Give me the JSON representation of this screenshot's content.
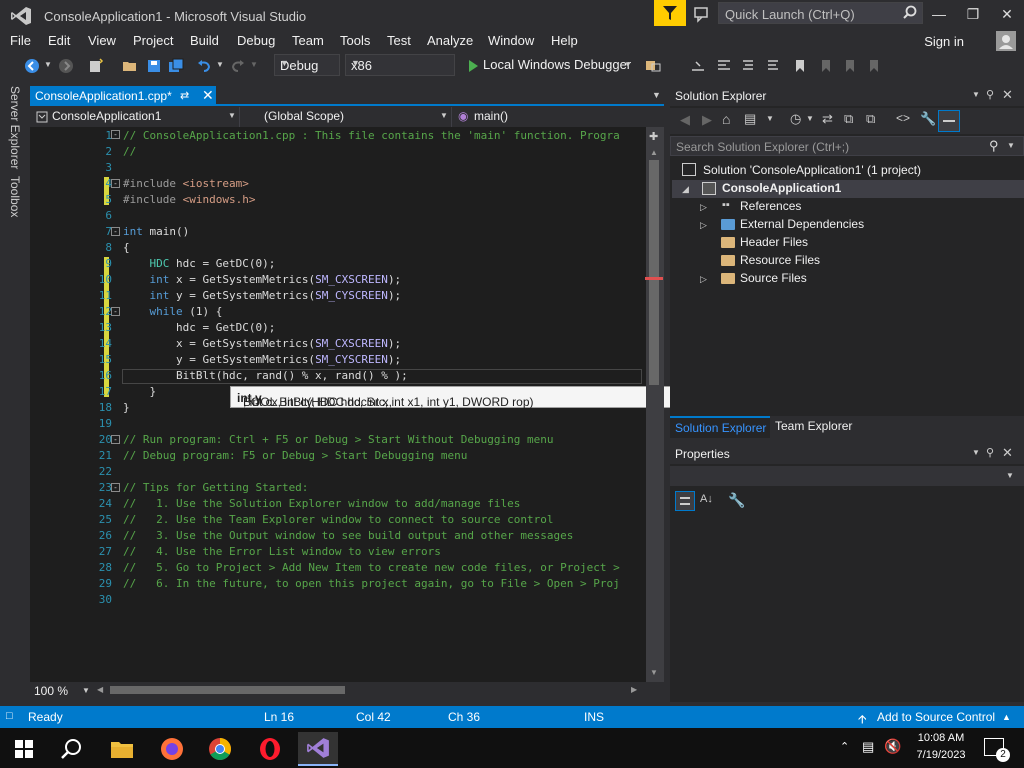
{
  "window": {
    "title": "ConsoleApplication1 - Microsoft Visual Studio",
    "quick_launch_placeholder": "Quick Launch (Ctrl+Q)"
  },
  "menu": [
    "File",
    "Edit",
    "View",
    "Project",
    "Build",
    "Debug",
    "Team",
    "Tools",
    "Test",
    "Analyze",
    "Window",
    "Help"
  ],
  "account": {
    "sign_in": "Sign in"
  },
  "toolbar": {
    "config": "Debug",
    "platform": "x86",
    "run_label": "Local Windows Debugger"
  },
  "left_rail": [
    "Server Explorer",
    "Toolbox"
  ],
  "editor": {
    "tab_name": "ConsoleApplication1.cpp*",
    "nav": {
      "project": "ConsoleApplication1",
      "scope": "(Global Scope)",
      "member": "main()"
    },
    "zoom": "100 %",
    "lines": [
      {
        "n": "1",
        "html": "<span class='c-com'>// ConsoleApplication1.cpp : This file contains the 'main' function. Progra</span>"
      },
      {
        "n": "2",
        "html": "<span class='c-com'>//</span>"
      },
      {
        "n": "3",
        "html": ""
      },
      {
        "n": "4",
        "html": "<span class='c-pre'>#include</span> <span class='c-str'>&lt;iostream&gt;</span>"
      },
      {
        "n": "5",
        "html": "<span class='c-pre'>#include</span> <span class='c-str'>&lt;windows.h&gt;</span>"
      },
      {
        "n": "6",
        "html": ""
      },
      {
        "n": "7",
        "html": "<span class='c-kw'>int</span> main()"
      },
      {
        "n": "8",
        "html": "{"
      },
      {
        "n": "9",
        "html": "    <span class='c-ty'>HDC</span> hdc = GetDC(0);"
      },
      {
        "n": "10",
        "html": "    <span class='c-kw'>int</span> x = GetSystemMetrics(<span class='c-mac'>SM_CXSCREEN</span>);"
      },
      {
        "n": "11",
        "html": "    <span class='c-kw'>int</span> y = GetSystemMetrics(<span class='c-mac'>SM_CYSCREEN</span>);"
      },
      {
        "n": "12",
        "html": "    <span class='c-kw'>while</span> (1) {"
      },
      {
        "n": "13",
        "html": "        hdc = GetDC(0);"
      },
      {
        "n": "14",
        "html": "        x = GetSystemMetrics(<span class='c-mac'>SM_CXSCREEN</span>);"
      },
      {
        "n": "15",
        "html": "        y = GetSystemMetrics(<span class='c-mac'>SM_CYSCREEN</span>);"
      },
      {
        "n": "16",
        "html": "        BitBlt(hdc, rand() % x, rand() % );"
      },
      {
        "n": "17",
        "html": "    }"
      },
      {
        "n": "18",
        "html": "}"
      },
      {
        "n": "19",
        "html": ""
      },
      {
        "n": "20",
        "html": "<span class='c-com'>// Run program: Ctrl + F5 or Debug &gt; Start Without Debugging menu</span>"
      },
      {
        "n": "21",
        "html": "<span class='c-com'>// Debug program: F5 or Debug &gt; Start Debugging menu</span>"
      },
      {
        "n": "22",
        "html": ""
      },
      {
        "n": "23",
        "html": "<span class='c-com'>// Tips for Getting Started:</span>"
      },
      {
        "n": "24",
        "html": "<span class='c-com'>//   1. Use the Solution Explorer window to add/manage files</span>"
      },
      {
        "n": "25",
        "html": "<span class='c-com'>//   2. Use the Team Explorer window to connect to source control</span>"
      },
      {
        "n": "26",
        "html": "<span class='c-com'>//   3. Use the Output window to see build output and other messages</span>"
      },
      {
        "n": "27",
        "html": "<span class='c-com'>//   4. Use the Error List window to view errors</span>"
      },
      {
        "n": "28",
        "html": "<span class='c-com'>//   5. Go to Project &gt; Add New Item to create new code files, or Project &gt;</span>"
      },
      {
        "n": "29",
        "html": "<span class='c-com'>//   6. In the future, to open this project again, go to File &gt; Open &gt; Proj</span>"
      },
      {
        "n": "30",
        "html": ""
      }
    ],
    "tooltip": {
      "pre": "BOOL BitBlt(HDC hdc, int x, ",
      "bold": "int y",
      "post": ", int cx, int cy, HDC hdcSrc, int x1, int y1, DWORD rop)"
    }
  },
  "solution_explorer": {
    "title": "Solution Explorer",
    "search_placeholder": "Search Solution Explorer (Ctrl+;)",
    "solution": "Solution 'ConsoleApplication1' (1 project)",
    "project": "ConsoleApplication1",
    "items": [
      "References",
      "External Dependencies",
      "Header Files",
      "Resource Files",
      "Source Files"
    ],
    "tabs": [
      "Solution Explorer",
      "Team Explorer"
    ]
  },
  "properties": {
    "title": "Properties"
  },
  "status": {
    "state": "Ready",
    "ln": "Ln 16",
    "col": "Col 42",
    "ch": "Ch 36",
    "mode": "INS",
    "source_control": "Add to Source Control"
  },
  "taskbar": {
    "time": "10:08 AM",
    "date": "7/19/2023",
    "notif_count": "2"
  }
}
